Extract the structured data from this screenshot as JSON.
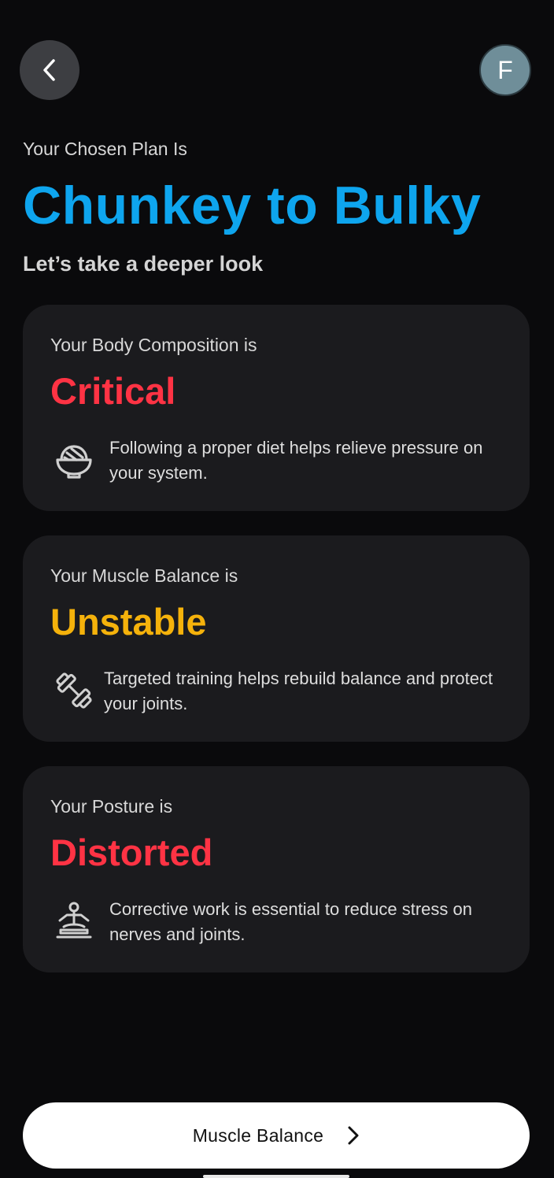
{
  "header": {
    "back_icon": "chevron-left-icon",
    "avatar_initial": "F"
  },
  "plan": {
    "eyebrow": "Your Chosen Plan Is",
    "title": "Chunkey to Bulky",
    "subtitle": "Let’s take a deeper look"
  },
  "colors": {
    "accent": "#0ea5ee",
    "critical": "#ff3344",
    "warning": "#f5b20b",
    "card_bg": "#1b1b1e"
  },
  "cards": [
    {
      "label": "Your Body Composition is",
      "status": "Critical",
      "status_color": "#ff3344",
      "icon": "food-bowl-icon",
      "text": "Following a proper diet helps relieve pressure on your system."
    },
    {
      "label": "Your Muscle Balance is",
      "status": "Unstable",
      "status_color": "#f5b20b",
      "icon": "dumbbell-icon",
      "text": "Targeted training helps rebuild balance and protect your joints."
    },
    {
      "label": "Your Posture is",
      "status": "Distorted",
      "status_color": "#ff3344",
      "icon": "meditation-icon",
      "text": "Corrective work is essential to reduce stress on nerves and joints."
    }
  ],
  "cta": {
    "label": "Muscle Balance",
    "icon": "chevron-right-icon"
  }
}
